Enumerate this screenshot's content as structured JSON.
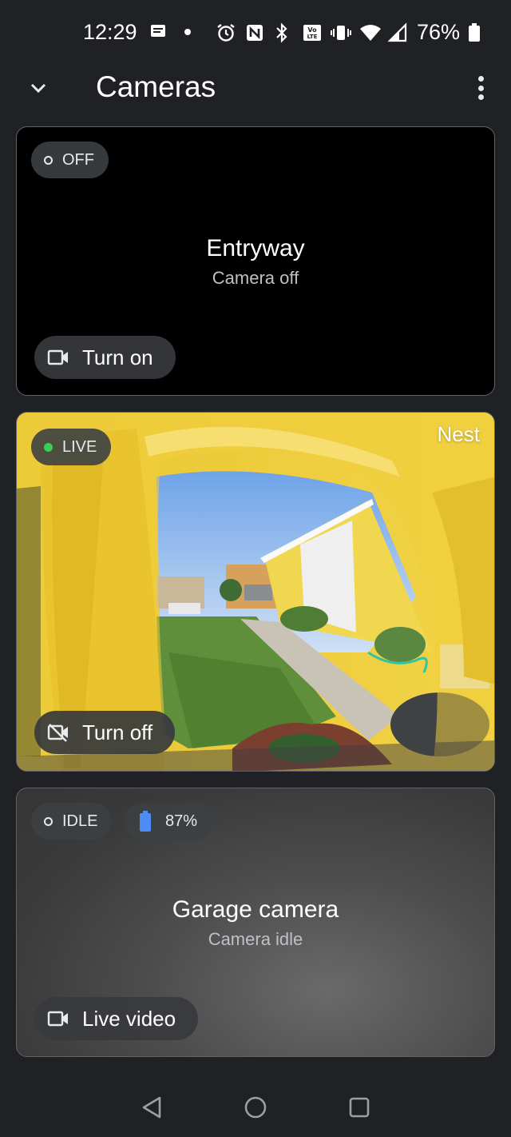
{
  "status_bar": {
    "time": "12:29",
    "battery_percent": "76%"
  },
  "app_bar": {
    "title": "Cameras"
  },
  "cameras": [
    {
      "status_label": "OFF",
      "name": "Entryway",
      "state_text": "Camera off",
      "action_label": "Turn on"
    },
    {
      "status_label": "LIVE",
      "brand": "Nest",
      "action_label": "Turn off",
      "status_color": "#34d058"
    },
    {
      "status_label": "IDLE",
      "battery_label": "87%",
      "battery_color": "#4c8df6",
      "name": "Garage camera",
      "state_text": "Camera idle",
      "action_label": "Live video"
    }
  ],
  "colors": {
    "background": "#202124",
    "card_border": "#5f6368",
    "chip_bg": "#3c4043"
  }
}
